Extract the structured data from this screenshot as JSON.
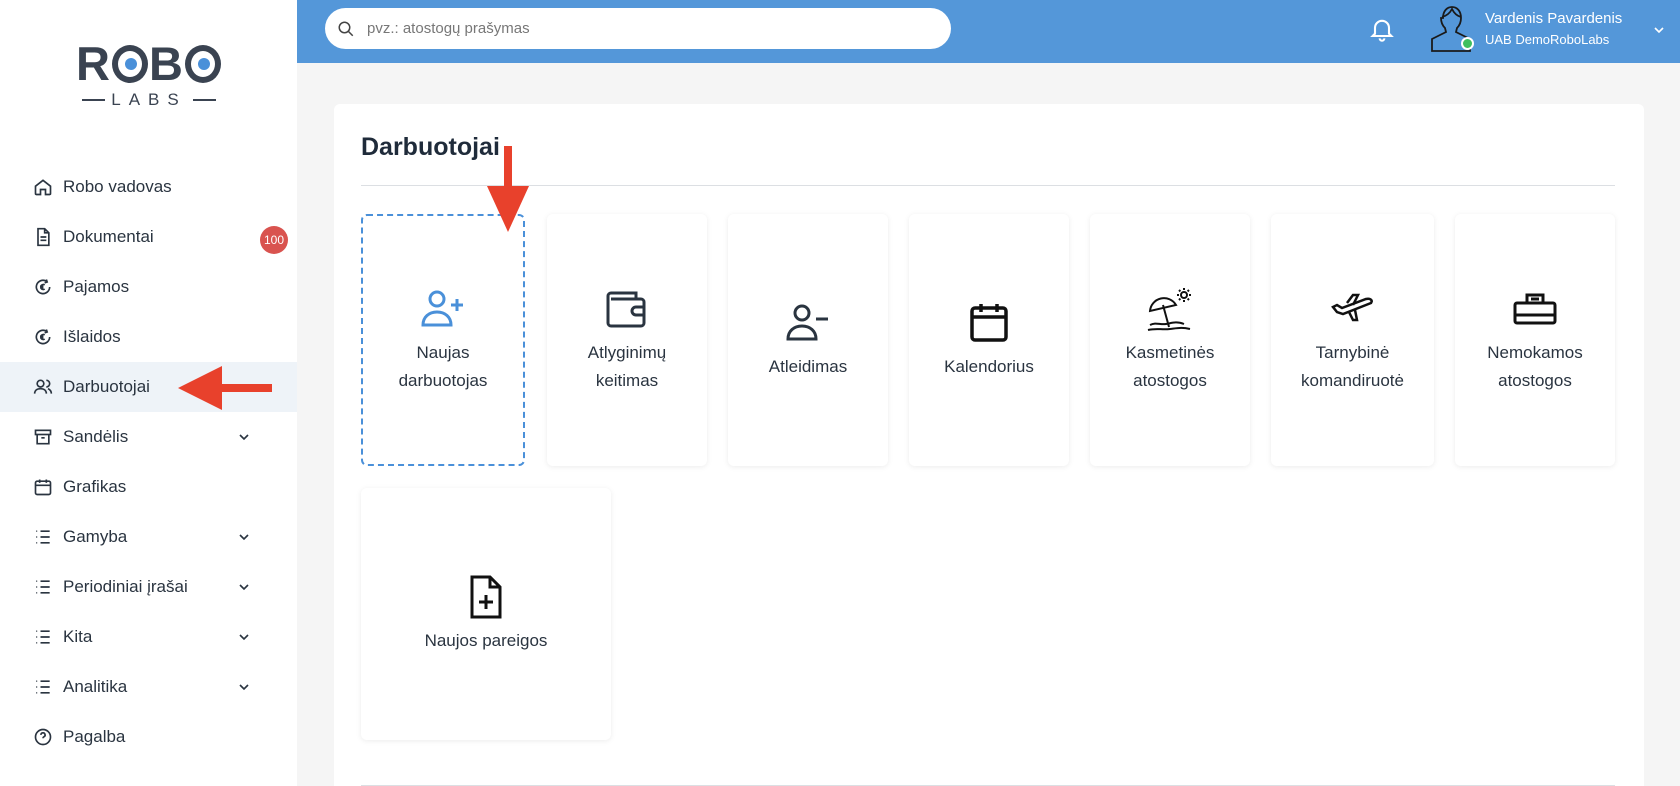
{
  "logo": {
    "top": "ROBO",
    "bottom": "LABS"
  },
  "sidebar": {
    "items": [
      {
        "label": "Robo vadovas",
        "icon": "home-icon"
      },
      {
        "label": "Dokumentai",
        "icon": "document-icon",
        "badge": "100"
      },
      {
        "label": "Pajamos",
        "icon": "euro-income-icon"
      },
      {
        "label": "Išlaidos",
        "icon": "euro-expense-icon"
      },
      {
        "label": "Darbuotojai",
        "icon": "users-icon",
        "active": true
      },
      {
        "label": "Sandėlis",
        "icon": "archive-icon",
        "expandable": true
      },
      {
        "label": "Grafikas",
        "icon": "calendar-icon"
      },
      {
        "label": "Gamyba",
        "icon": "list-icon",
        "expandable": true
      },
      {
        "label": "Periodiniai įrašai",
        "icon": "list-icon",
        "expandable": true
      },
      {
        "label": "Kita",
        "icon": "list-icon",
        "expandable": true
      },
      {
        "label": "Analitika",
        "icon": "list-icon",
        "expandable": true
      },
      {
        "label": "Pagalba",
        "icon": "help-icon"
      }
    ]
  },
  "search": {
    "placeholder": "pvz.: atostogų prašymas",
    "value": ""
  },
  "user": {
    "name": "Vardenis Pavardenis",
    "company": "UAB DemoRoboLabs"
  },
  "main": {
    "title": "Darbuotojai",
    "tiles": [
      {
        "label": "Naujas darbuotojas",
        "icon": "user-plus-icon",
        "highlighted": true
      },
      {
        "label": "Atlyginimų keitimas",
        "icon": "wallet-icon"
      },
      {
        "label": "Atleidimas",
        "icon": "user-minus-icon"
      },
      {
        "label": "Kalendorius",
        "icon": "calendar-icon"
      },
      {
        "label": "Kasmetinės atostogos",
        "icon": "beach-umbrella-icon"
      },
      {
        "label": "Tarnybinė komandiruotė",
        "icon": "airplane-icon"
      },
      {
        "label": "Nemokamos atostogos",
        "icon": "cash-register-icon"
      },
      {
        "label": "Naujos pareigos",
        "icon": "file-plus-icon"
      }
    ]
  },
  "colors": {
    "topbar": "#5497d9",
    "accent": "#4a90d9",
    "badge": "#d9534f",
    "arrow": "#e8412c",
    "online": "#3fbf5f"
  }
}
